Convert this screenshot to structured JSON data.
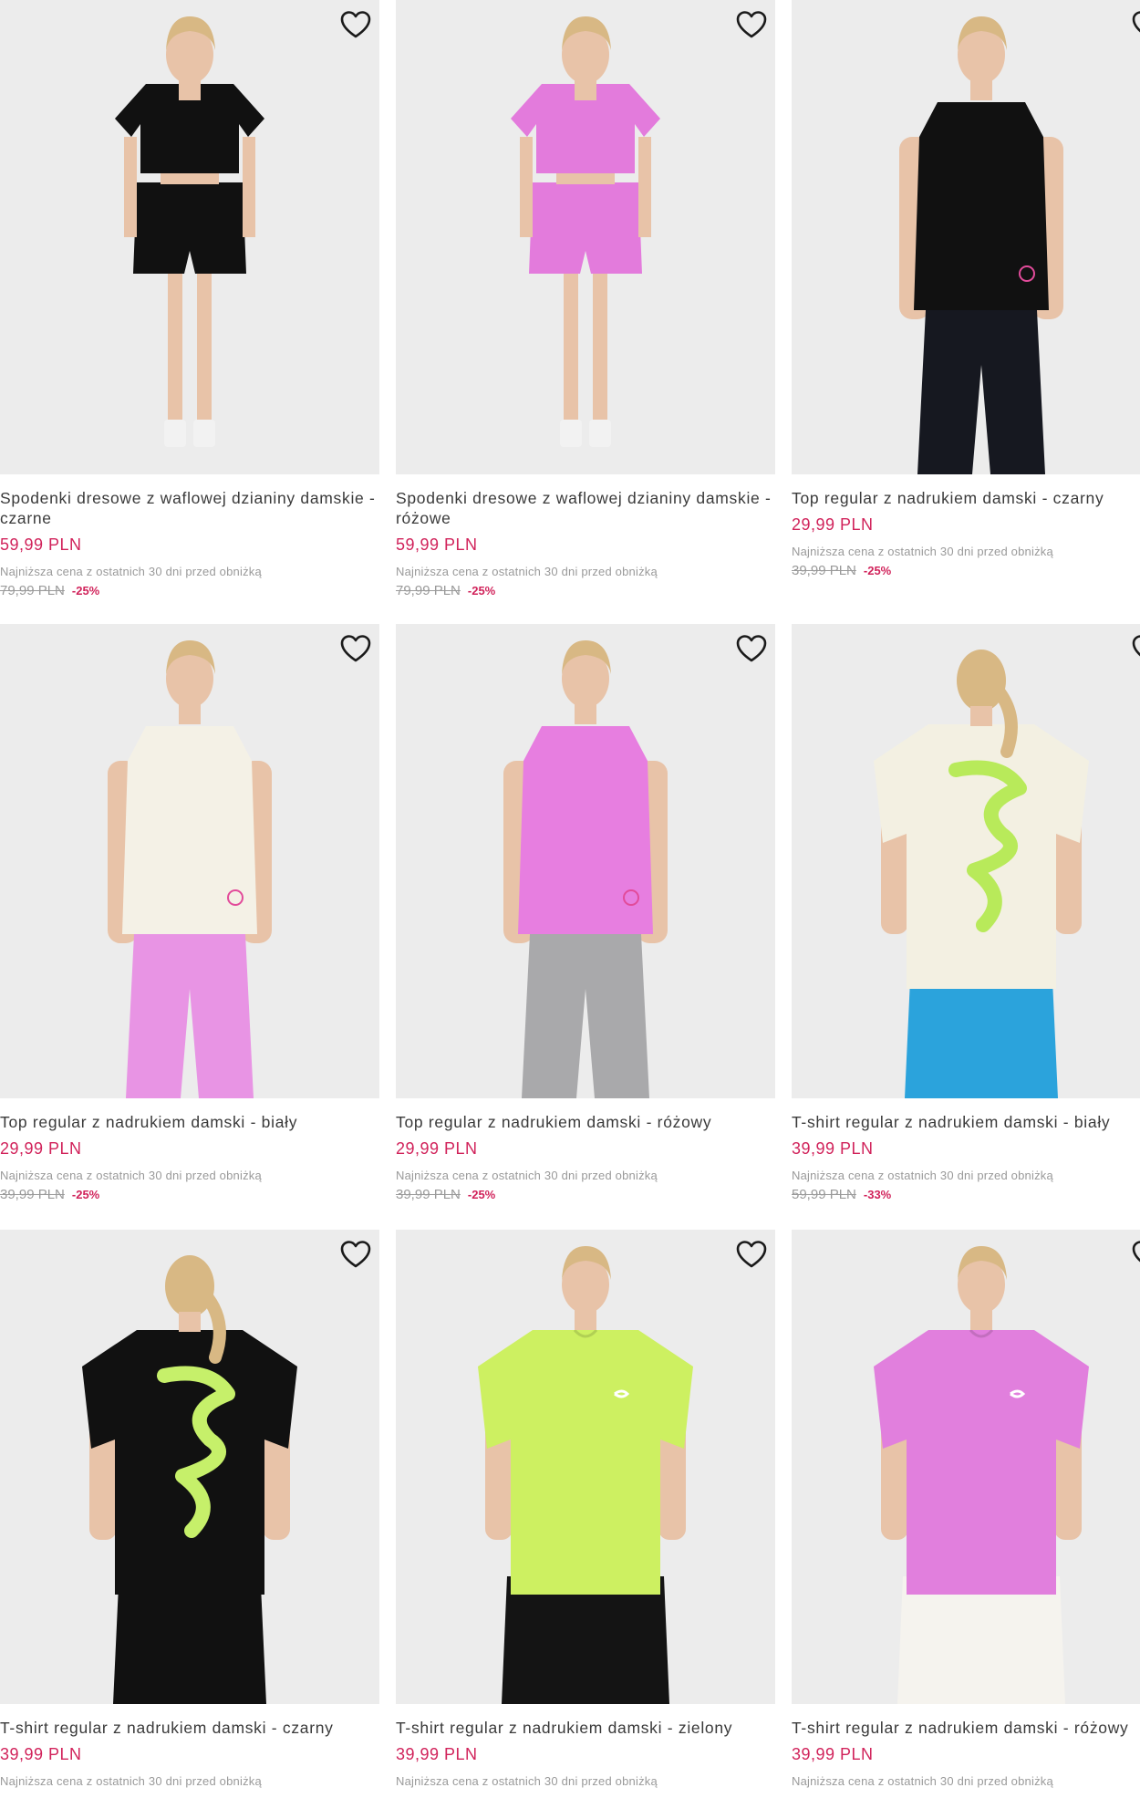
{
  "colors": {
    "price": "#d1235b",
    "image_bg": "#ececec",
    "muted_text": "#9a9a9a"
  },
  "icons": {
    "wishlist": "heart-outline-icon"
  },
  "products": [
    {
      "name": "Spodenki dresowe z waflowej dzianiny damskie - czarne",
      "price": "59,99 PLN",
      "lowest_note": "Najniższa cena z ostatnich 30 dni przed obniżką",
      "old_price": "79,99 PLN",
      "discount": "-25%",
      "visual": {
        "top": "#111111",
        "bottom": "#111111",
        "style": "tee-shorts"
      }
    },
    {
      "name": "Spodenki dresowe z waflowej dzianiny damskie - różowe",
      "price": "59,99 PLN",
      "lowest_note": "Najniższa cena z ostatnich 30 dni przed obniżką",
      "old_price": "79,99 PLN",
      "discount": "-25%",
      "visual": {
        "top": "#e37bdc",
        "bottom": "#e37bdc",
        "style": "tee-shorts"
      }
    },
    {
      "name": "Top regular z nadrukiem damski - czarny",
      "price": "29,99 PLN",
      "lowest_note": "Najniższa cena z ostatnich 30 dni przed obniżką",
      "old_price": "39,99 PLN",
      "discount": "-25%",
      "visual": {
        "top": "#111111",
        "bottom": "#161820",
        "style": "tank-leggings"
      }
    },
    {
      "name": "Top regular z nadrukiem damski - biały",
      "price": "29,99 PLN",
      "lowest_note": "Najniższa cena z ostatnich 30 dni przed obniżką",
      "old_price": "39,99 PLN",
      "discount": "-25%",
      "visual": {
        "top": "#f4f1e6",
        "bottom": "#e894e4",
        "style": "tank-leggings"
      }
    },
    {
      "name": "Top regular z nadrukiem damski - różowy",
      "price": "29,99 PLN",
      "lowest_note": "Najniższa cena z ostatnich 30 dni przed obniżką",
      "old_price": "39,99 PLN",
      "discount": "-25%",
      "visual": {
        "top": "#e77ee0",
        "bottom": "#a9a9ab",
        "style": "tank-leggings"
      }
    },
    {
      "name": "T-shirt regular z nadrukiem damski - biały",
      "price": "39,99 PLN",
      "lowest_note": "Najniższa cena z ostatnich 30 dni przed obniżką",
      "old_price": "59,99 PLN",
      "discount": "-33%",
      "visual": {
        "top": "#f3f0e2",
        "bottom": "#2ba3dc",
        "style": "tee-back",
        "print": "#b8ea5a"
      }
    },
    {
      "name": "T-shirt regular z nadrukiem damski - czarny",
      "price": "39,99 PLN",
      "lowest_note": "Najniższa cena z ostatnich 30 dni przed obniżką",
      "old_price": "",
      "discount": "",
      "visual": {
        "top": "#111111",
        "bottom": "#111111",
        "style": "tee-back",
        "print": "#c6f06a"
      }
    },
    {
      "name": "T-shirt regular z nadrukiem damski - zielony",
      "price": "39,99 PLN",
      "lowest_note": "Najniższa cena z ostatnich 30 dni przed obniżką",
      "old_price": "",
      "discount": "",
      "visual": {
        "top": "#cdf061",
        "bottom": "#141414",
        "style": "tee-front"
      }
    },
    {
      "name": "T-shirt regular z nadrukiem damski - różowy",
      "price": "39,99 PLN",
      "lowest_note": "Najniższa cena z ostatnich 30 dni przed obniżką",
      "old_price": "",
      "discount": "",
      "visual": {
        "top": "#e17fdd",
        "bottom": "#f5f3ee",
        "style": "tee-front"
      }
    }
  ]
}
